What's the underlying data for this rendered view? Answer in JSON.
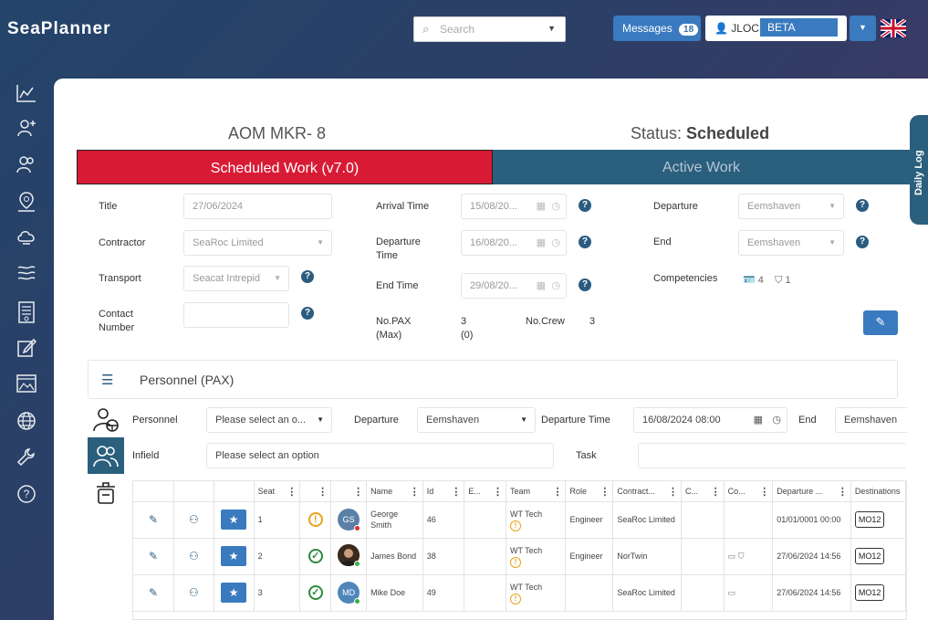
{
  "header": {
    "logo": "SeaPlanner",
    "search_placeholder": "Search",
    "messages_label": "Messages",
    "messages_count": "18",
    "user": "JLOCK",
    "env": "BETA"
  },
  "sidebar_icons": [
    "chart-icon",
    "add-user-icon",
    "users-icon",
    "location-pin-icon",
    "cloud-icon",
    "helicopter-icon",
    "checklist-icon",
    "edit-icon",
    "picture-icon",
    "globe-icon",
    "wrench-icon",
    "help-icon"
  ],
  "daily_log": "Daily Log",
  "job": {
    "title": "AOM MKR- 8",
    "status_label": "Status:",
    "status_value": "Scheduled"
  },
  "tabs": {
    "scheduled": "Scheduled Work (v7.0)",
    "active": "Active Work"
  },
  "form": {
    "title_label": "Title",
    "title_value": "27/06/2024",
    "contractor_label": "Contractor",
    "contractor_value": "SeaRoc Limited",
    "transport_label": "Transport",
    "transport_value": "Seacat Intrepid",
    "contact_label": "Contact Number",
    "contact_value": "",
    "arrival_label": "Arrival Time",
    "arrival_value": "15/08/20...",
    "departure_time_label": "Departure Time",
    "departure_time_value": "16/08/20...",
    "end_time_label": "End Time",
    "end_time_value": "29/08/20...",
    "nopax_label": "No.PAX (Max)",
    "nopax_value": "3 (0)",
    "nocrew_label": "No.Crew",
    "nocrew_value": "3",
    "departure_label": "Departure",
    "departure_value": "Eemshaven",
    "end_label": "End",
    "end_value": "Eemshaven",
    "competencies_label": "Competencies",
    "comp_count_a": "4",
    "comp_count_b": "1"
  },
  "personnel": {
    "section_title": "Personnel (PAX)",
    "personnel_label": "Personnel",
    "personnel_placeholder": "Please select an o...",
    "departure_label": "Departure",
    "departure_value": "Eemshaven",
    "departure_time_label": "Departure Time",
    "departure_time_value": "16/08/2024 08:00",
    "end_label": "End",
    "end_value": "Eemshaven",
    "infield_label": "Infield",
    "infield_placeholder": "Please select an option",
    "task_label": "Task"
  },
  "table": {
    "columns": [
      "Seat",
      "",
      "",
      "Name",
      "Id",
      "E...",
      "Team",
      "Role",
      "Contract...",
      "C...",
      "Co...",
      "Departure ...",
      "Destinations"
    ],
    "rows": [
      {
        "seat": "1",
        "status": "warn",
        "initials": "GS",
        "avatar_dot": "#e03030",
        "name": "George Smith",
        "id": "46",
        "team": "WT Tech",
        "role": "Engineer",
        "contractor": "SeaRoc Limited",
        "competencies": "",
        "departure": "01/01/0001 00:00",
        "destination": "MO12"
      },
      {
        "seat": "2",
        "status": "ok",
        "initials": "",
        "avatar_dot": "#3cb043",
        "name": "James Bond",
        "id": "38",
        "team": "WT Tech",
        "role": "Engineer",
        "contractor": "NorTwin",
        "competencies": "cert-icons",
        "departure": "27/06/2024 14:56",
        "destination": "MO12"
      },
      {
        "seat": "3",
        "status": "ok",
        "initials": "MD",
        "avatar_dot": "#3cb043",
        "name": "Mike Doe",
        "id": "49",
        "team": "WT Tech",
        "role": "",
        "contractor": "SeaRoc Limited",
        "competencies": "cert-icon",
        "departure": "27/06/2024 14:56",
        "destination": "MO12"
      }
    ]
  }
}
